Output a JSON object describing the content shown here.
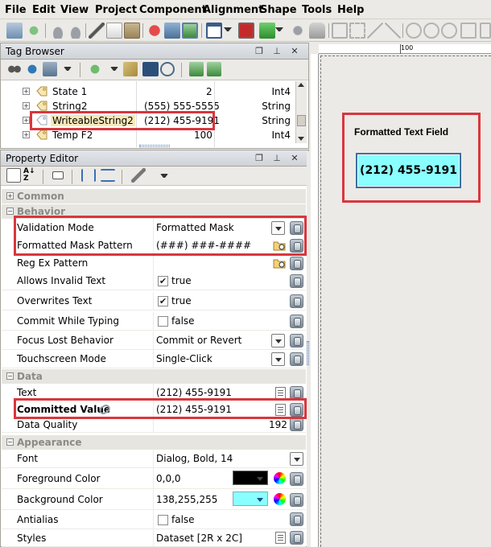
{
  "menubar": {
    "items": [
      "File",
      "Edit",
      "View",
      "Project",
      "Component",
      "Alignment",
      "Shape",
      "Tools",
      "Help"
    ]
  },
  "tag_browser": {
    "title": "Tag Browser",
    "rows": [
      {
        "name": "State 1",
        "value": "2",
        "type": "Int4"
      },
      {
        "name": "String2",
        "value": "(555) 555-5555",
        "type": "String"
      },
      {
        "name": "WriteableString2",
        "value": "(212) 455-9191",
        "type": "String"
      },
      {
        "name": "Temp F2",
        "value": "100",
        "type": "Int4"
      }
    ]
  },
  "property_editor": {
    "title": "Property Editor",
    "categories": {
      "common": "Common",
      "behavior": "Behavior",
      "data": "Data",
      "appearance": "Appearance"
    },
    "properties": {
      "validation_mode": {
        "name": "Validation Mode",
        "value": "Formatted Mask"
      },
      "formatted_mask_pattern": {
        "name": "Formatted Mask Pattern",
        "value": "(###) ###-####"
      },
      "reg_ex_pattern": {
        "name": "Reg Ex Pattern",
        "value": ""
      },
      "allows_invalid_text": {
        "name": "Allows Invalid Text",
        "value": "true"
      },
      "overwrites_text": {
        "name": "Overwrites Text",
        "value": "true"
      },
      "commit_while_typing": {
        "name": "Commit While Typing",
        "value": "false"
      },
      "focus_lost_behavior": {
        "name": "Focus Lost Behavior",
        "value": "Commit or Revert"
      },
      "touchscreen_mode": {
        "name": "Touchscreen Mode",
        "value": "Single-Click"
      },
      "text": {
        "name": "Text",
        "value": "(212) 455-9191"
      },
      "committed_value": {
        "name": "Committed Value",
        "value": "(212) 455-9191"
      },
      "data_quality": {
        "name": "Data Quality",
        "value": "192"
      },
      "font": {
        "name": "Font",
        "value": "Dialog, Bold, 14"
      },
      "foreground_color": {
        "name": "Foreground Color",
        "value": "0,0,0",
        "swatch": "#000000"
      },
      "background_color": {
        "name": "Background Color",
        "value": "138,255,255",
        "swatch": "#8affff"
      },
      "antialias": {
        "name": "Antialias",
        "value": "false"
      },
      "styles": {
        "name": "Styles",
        "value": "Dataset [2R x 2C]"
      }
    }
  },
  "designer": {
    "ruler_label": "100",
    "component_label": "Formatted Text Field",
    "field_value": "(212) 455-9191",
    "field_bg": "#8affff"
  },
  "colors": {
    "highlight": "#d9363e"
  }
}
